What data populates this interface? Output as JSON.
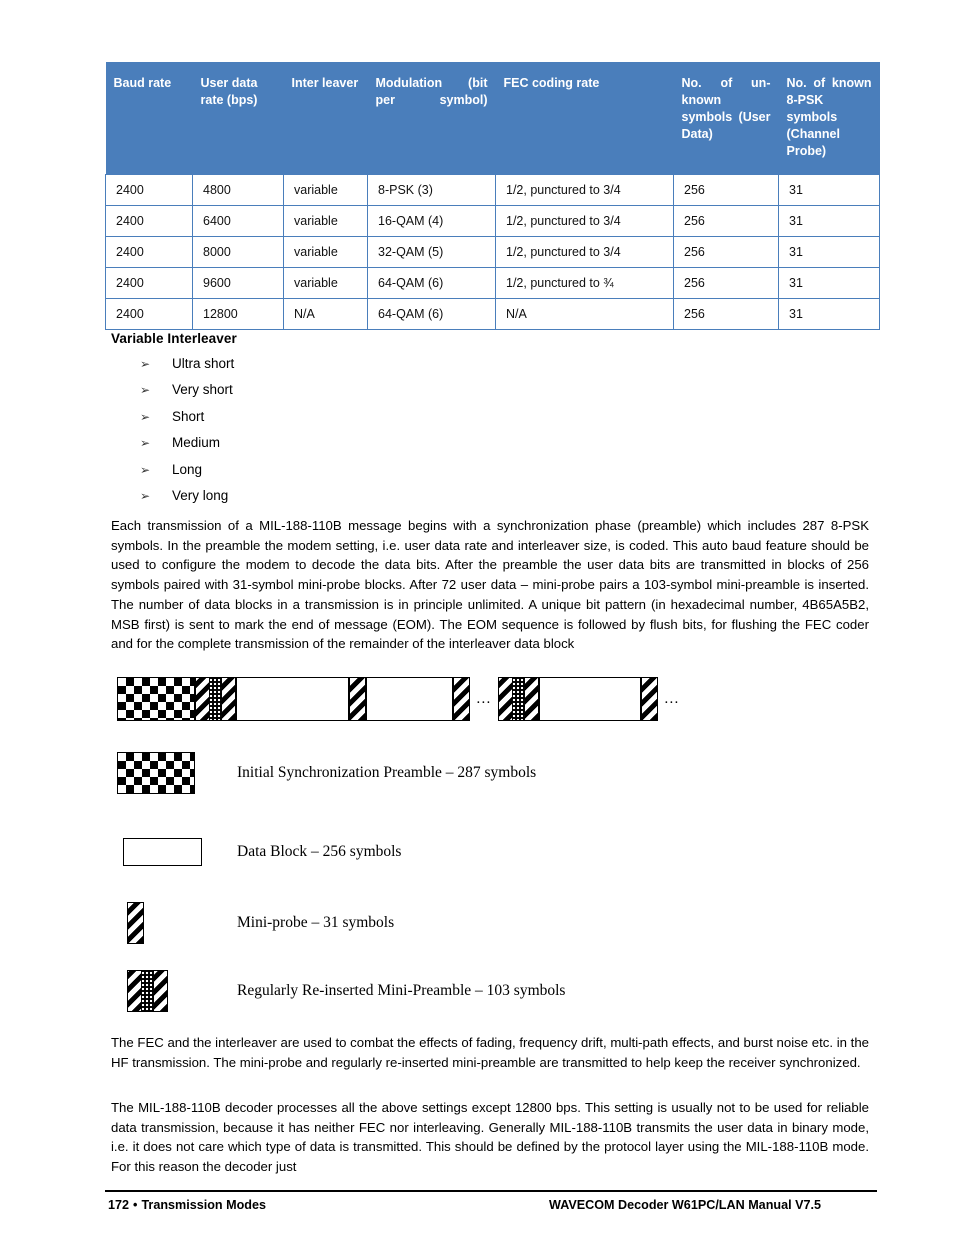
{
  "table": {
    "headers": [
      "Baud rate",
      "User data rate (bps)",
      "Inter leaver",
      "Modulation (bit per symbol)",
      "FEC coding rate",
      "No. of un-known symbols (User Data)",
      "No. of known 8-PSK symbols (Channel Probe)"
    ],
    "rows": [
      [
        "2400",
        "4800",
        "variable",
        "8-PSK (3)",
        "1/2, punctured to 3/4",
        "256",
        "31"
      ],
      [
        "2400",
        "6400",
        "variable",
        "16-QAM (4)",
        "1/2, punctured to 3/4",
        "256",
        "31"
      ],
      [
        "2400",
        "8000",
        "variable",
        "32-QAM (5)",
        "1/2, punctured to 3/4",
        "256",
        "31"
      ],
      [
        "2400",
        "9600",
        "variable",
        "64-QAM (6)",
        "1/2, punctured to ¾",
        "256",
        "31"
      ],
      [
        "2400",
        "12800",
        "N/A",
        "64-QAM (6)",
        "N/A",
        "256",
        "31"
      ]
    ],
    "header_color": "#4a7ebb"
  },
  "section": {
    "heading": "Variable Interleaver",
    "bullet_glyph": "➢",
    "items": [
      "Ultra short",
      "Very short",
      "Short",
      "Medium",
      "Long",
      "Very long"
    ]
  },
  "paragraphs": {
    "main": "Each transmission of a MIL-188-110B message begins with a synchronization phase (preamble) which includes 287 8-PSK symbols. In the preamble the modem setting, i.e. user data rate and interleaver size, is coded. This auto baud feature should be used to configure the modem to decode the data bits. After the preamble the user data bits are transmitted in blocks of 256 symbols paired with 31-symbol mini-probe blocks. After 72 user data – mini-probe pairs a 103-symbol mini-preamble is inserted. The number of data blocks in a transmission is in principle unlimited. A unique bit pattern (in hexadecimal number, 4B65A5B2, MSB first) is sent to mark the end of message (EOM). The EOM sequence is followed by flush bits, for flushing the FEC coder and for the complete transmission of the remainder of the interleaver data block",
    "fec": "The FEC and the interleaver are used to combat the effects of fading, frequency drift, multi-path effects, and burst noise etc. in the HF transmission. The mini-probe and regularly re-inserted mini-preamble are transmitted to help keep the receiver synchronized.",
    "decoder": " The MIL-188-110B decoder processes all the above settings except 12800 bps. This setting is usually not to be used for reliable data transmission, because it has neither FEC nor interleaving. Generally MIL-188-110B transmits the user data in binary mode, i.e. it does not care which type of data is transmitted. This should be defined by the protocol layer using the MIL-188-110B mode. For this reason the decoder just"
  },
  "diagram": {
    "ellipsis": "…",
    "legend": {
      "preamble": "Initial Synchronization Preamble – 287 symbols",
      "data_block": "Data Block – 256 symbols",
      "mini_probe": "Mini-probe – 31 symbols",
      "mini_preamble": "Regularly Re-inserted Mini-Preamble – 103 symbols"
    }
  },
  "footer": {
    "page_number": "172",
    "separator": "•",
    "section_name": "Transmission Modes",
    "manual_title": "WAVECOM Decoder W61PC/LAN Manual V7.5"
  }
}
